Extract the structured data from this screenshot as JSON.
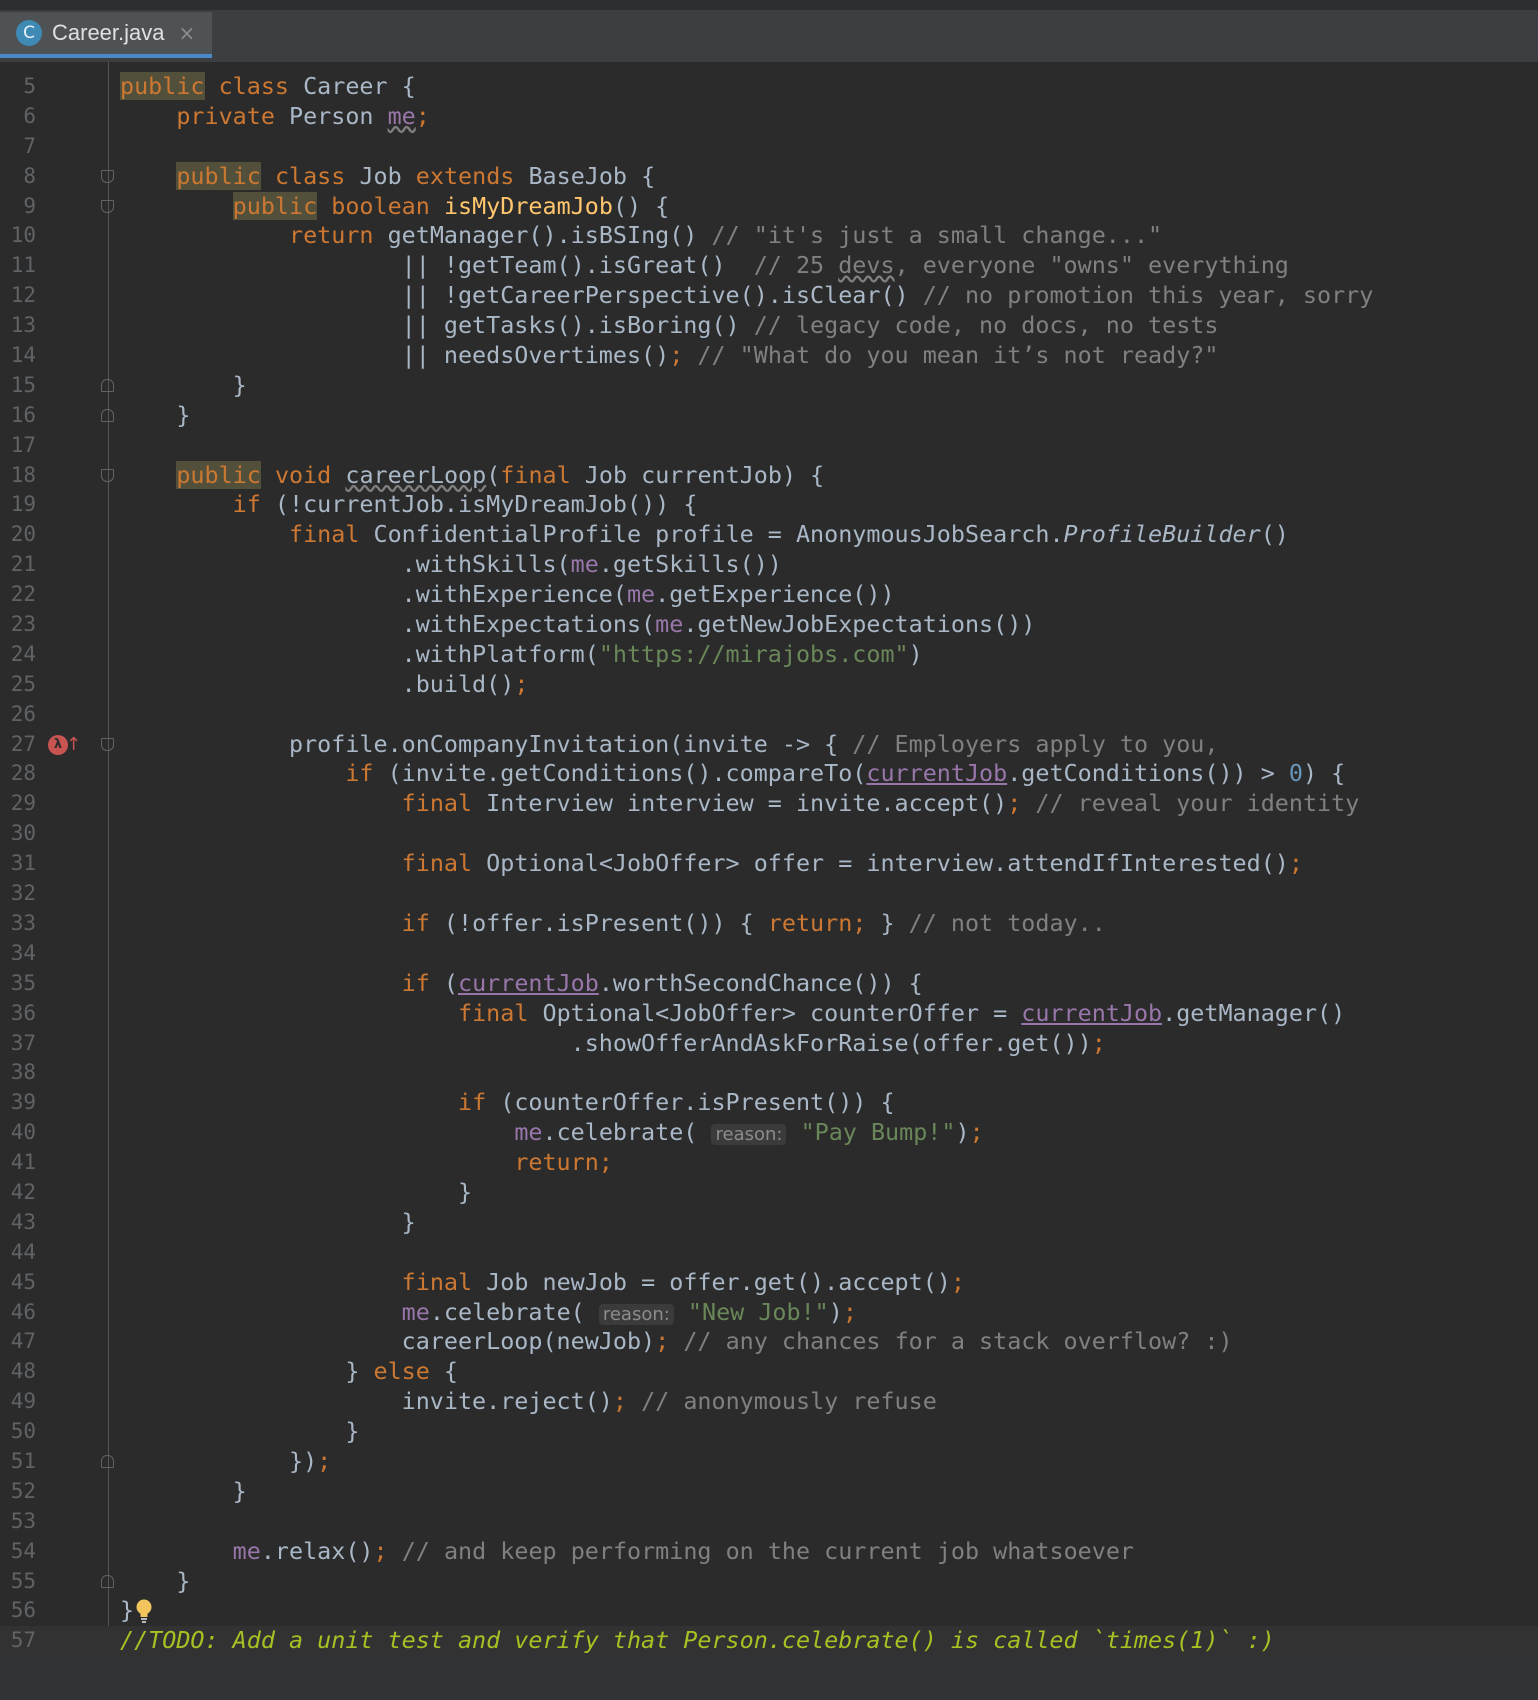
{
  "tab": {
    "title": "Career.java",
    "icon": "C",
    "close": "×"
  },
  "code_lines": [
    {
      "n": "5",
      "t": "public class Career {"
    },
    {
      "n": "6",
      "t": "    private Person me;"
    },
    {
      "n": "7",
      "t": ""
    },
    {
      "n": "8",
      "t": "    public class Job extends BaseJob {"
    },
    {
      "n": "9",
      "t": "        public boolean isMyDreamJob() {"
    },
    {
      "n": "10",
      "t": "            return getManager().isBSIng() // \"it's just a small change...\""
    },
    {
      "n": "11",
      "t": "                    || !getTeam().isGreat()  // 25 devs, everyone \"owns\" everything"
    },
    {
      "n": "12",
      "t": "                    || !getCareerPerspective().isClear() // no promotion this year, sorry"
    },
    {
      "n": "13",
      "t": "                    || getTasks().isBoring() // legacy code, no docs, no tests"
    },
    {
      "n": "14",
      "t": "                    || needsOvertimes(); // \"What do you mean it’s not ready?\""
    },
    {
      "n": "15",
      "t": "        }"
    },
    {
      "n": "16",
      "t": "    }"
    },
    {
      "n": "17",
      "t": ""
    },
    {
      "n": "18",
      "t": "    public void careerLoop(final Job currentJob) {"
    },
    {
      "n": "19",
      "t": "        if (!currentJob.isMyDreamJob()) {"
    },
    {
      "n": "20",
      "t": "            final ConfidentialProfile profile = AnonymousJobSearch.ProfileBuilder()"
    },
    {
      "n": "21",
      "t": "                    .withSkills(me.getSkills())"
    },
    {
      "n": "22",
      "t": "                    .withExperience(me.getExperience())"
    },
    {
      "n": "23",
      "t": "                    .withExpectations(me.getNewJobExpectations())"
    },
    {
      "n": "24",
      "t": "                    .withPlatform(\"https://mirajobs.com\")"
    },
    {
      "n": "25",
      "t": "                    .build();"
    },
    {
      "n": "26",
      "t": ""
    },
    {
      "n": "27",
      "t": "            profile.onCompanyInvitation(invite -> { // Employers apply to you,"
    },
    {
      "n": "28",
      "t": "                if (invite.getConditions().compareTo(currentJob.getConditions()) > 0) {"
    },
    {
      "n": "29",
      "t": "                    final Interview interview = invite.accept(); // reveal your identity"
    },
    {
      "n": "30",
      "t": ""
    },
    {
      "n": "31",
      "t": "                    final Optional<JobOffer> offer = interview.attendIfInterested();"
    },
    {
      "n": "32",
      "t": ""
    },
    {
      "n": "33",
      "t": "                    if (!offer.isPresent()) { return; } // not today.."
    },
    {
      "n": "34",
      "t": ""
    },
    {
      "n": "35",
      "t": "                    if (currentJob.worthSecondChance()) {"
    },
    {
      "n": "36",
      "t": "                        final Optional<JobOffer> counterOffer = currentJob.getManager()"
    },
    {
      "n": "37",
      "t": "                                .showOfferAndAskForRaise(offer.get());"
    },
    {
      "n": "38",
      "t": ""
    },
    {
      "n": "39",
      "t": "                        if (counterOffer.isPresent()) {"
    },
    {
      "n": "40",
      "t": "                            me.celebrate( reason: \"Pay Bump!\");"
    },
    {
      "n": "41",
      "t": "                            return;"
    },
    {
      "n": "42",
      "t": "                        }"
    },
    {
      "n": "43",
      "t": "                    }"
    },
    {
      "n": "44",
      "t": ""
    },
    {
      "n": "45",
      "t": "                    final Job newJob = offer.get().accept();"
    },
    {
      "n": "46",
      "t": "                    me.celebrate( reason: \"New Job!\");"
    },
    {
      "n": "47",
      "t": "                    careerLoop(newJob); // any chances for a stack overflow? :)"
    },
    {
      "n": "48",
      "t": "                } else {"
    },
    {
      "n": "49",
      "t": "                    invite.reject(); // anonymously refuse"
    },
    {
      "n": "50",
      "t": "                }"
    },
    {
      "n": "51",
      "t": "            });"
    },
    {
      "n": "52",
      "t": "        }"
    },
    {
      "n": "53",
      "t": ""
    },
    {
      "n": "54",
      "t": "        me.relax(); // and keep performing on the current job whatsoever"
    },
    {
      "n": "55",
      "t": "    }"
    },
    {
      "n": "56",
      "t": "}"
    },
    {
      "n": "57",
      "t": "//TODO: Add a unit test and verify that Person.celebrate() is called `times(1)` :)"
    }
  ],
  "colors": {
    "background": "#2b2b2b",
    "keyword": "#cc7832",
    "method_declaration": "#ffc66d",
    "string": "#6a8759",
    "comment": "#808080",
    "field": "#9876aa",
    "number": "#6897bb",
    "todo": "#a8c023",
    "default_text": "#a9b7c6",
    "tab_underline": "#4a88c7"
  },
  "icons": {
    "tab_file": "java-class-icon",
    "gutter_line_27": "lambda-recursion-icon",
    "gutter_line_56": "lightbulb-icon",
    "fold_markers": "fold-icon"
  }
}
